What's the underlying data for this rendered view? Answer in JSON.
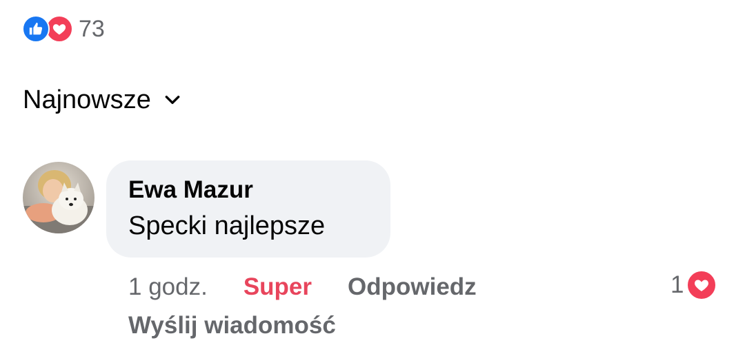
{
  "reactions": {
    "icons": [
      "thumbs-up-icon",
      "heart-icon"
    ],
    "count": "73",
    "colors": {
      "like": "#1877f2",
      "love": "#f33e58"
    }
  },
  "sort": {
    "label": "Najnowsze",
    "icon": "chevron-down-icon"
  },
  "comment": {
    "author": "Ewa Mazur",
    "text": "Specki najlepsze",
    "timestamp": "1 godz.",
    "reaction_action": "Super",
    "reply_action": "Odpowiedz",
    "send_message_action": "Wyślij wiadomość",
    "reaction_count": "1",
    "reaction_icon": "heart-icon",
    "colors": {
      "super": "#e8455c",
      "bubble": "#f0f2f5",
      "muted": "#65676b"
    }
  }
}
